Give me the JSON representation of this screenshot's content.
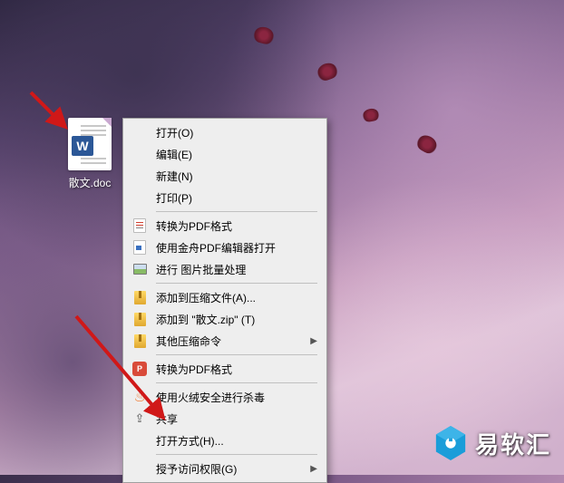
{
  "desktop_file": {
    "label": "散文.doc",
    "app_badge": "W"
  },
  "context_menu": {
    "open": "打开(O)",
    "edit": "编辑(E)",
    "new": "新建(N)",
    "print": "打印(P)",
    "to_pdf": "转换为PDF格式",
    "open_with_jzpdf": "使用金舟PDF编辑器打开",
    "batch_image": "进行 图片批量处理",
    "add_to_archive": "添加到压缩文件(A)...",
    "add_to_zip": "添加到 \"散文.zip\" (T)",
    "other_compress": "其他压缩命令",
    "wps_to_pdf": "转换为PDF格式",
    "huorong_scan": "使用火绒安全进行杀毒",
    "share": "共享",
    "open_with": "打开方式(H)...",
    "grant_access": "授予访问权限(G)",
    "wps_badge": "P"
  },
  "watermark": {
    "text": "易软汇"
  }
}
